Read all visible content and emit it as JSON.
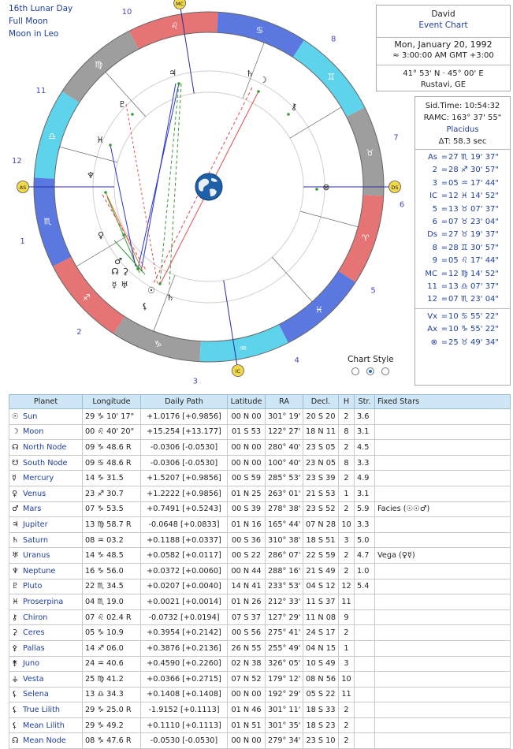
{
  "moon_info": {
    "line1": "16th Lunar Day",
    "line2": "Full Moon",
    "line3": "Moon in Leo"
  },
  "event": {
    "name": "David",
    "type": "Event Chart",
    "date": "Mon, January 20, 1992",
    "time": "≈ 3:00:00 AM  GMT +3:00",
    "coords": "41° 53' N · 45° 00' E",
    "place": "Rustavi, GE"
  },
  "sidereal": {
    "sid_time": "Sid.Time: 10:54:32",
    "ramc": "RAMC: 163° 37' 55\"",
    "system": "Placidus",
    "delta_t": "ΔT: 58.3 sec"
  },
  "cusps": [
    {
      "label": "As",
      "sign": "♏",
      "pos": "27 ♏ 19' 37\""
    },
    {
      "label": "2",
      "sign": "♐",
      "pos": "28 ♐ 30' 57\""
    },
    {
      "label": "3",
      "sign": "♒",
      "pos": "05 ♒ 17' 44\""
    },
    {
      "label": "IC",
      "sign": "♓",
      "pos": "12 ♓ 14' 52\""
    },
    {
      "label": "5",
      "sign": "♉",
      "pos": "13 ♉ 07' 37\""
    },
    {
      "label": "6",
      "sign": "♉",
      "pos": "07 ♉ 23' 04\""
    },
    {
      "label": "Ds",
      "sign": "♉",
      "pos": "27 ♉ 19' 37\""
    },
    {
      "label": "8",
      "sign": "♊",
      "pos": "28 ♊ 30' 57\""
    },
    {
      "label": "9",
      "sign": "♌",
      "pos": "05 ♌ 17' 44\""
    },
    {
      "label": "MC",
      "sign": "♍",
      "pos": "12 ♍ 14' 52\""
    },
    {
      "label": "11",
      "sign": "♎",
      "pos": "13 ♎ 07' 37\""
    },
    {
      "label": "12",
      "sign": "♏",
      "pos": "07 ♏ 23' 04\""
    }
  ],
  "cusps_display": [
    "27 ♏ 19' 37\"",
    "28 ♐ 30' 57\"",
    "05 ♒ 17' 44\"",
    "12 ♓ 14' 52\"",
    "13 ♉ 07' 37\"",
    "07 ♉ 23' 04\"",
    "27 ♉ 19' 37\"",
    "28 ♊ 30' 57\"",
    "05 ♌ 17' 44\"",
    "12 ♍ 14' 52\"",
    "13 ♎ 07' 37\"",
    "07 ♏ 23' 04\""
  ],
  "points": [
    {
      "label": "Vx",
      "value": "10 ♋ 55' 22\""
    },
    {
      "label": "Ax",
      "value": "10 ♑ 55' 22\""
    },
    {
      "label": "⊗",
      "value": "25 ♉ 49' 34\""
    }
  ],
  "chart_style_label": "Chart Style",
  "house_numbers": [
    "1",
    "2",
    "3",
    "4",
    "5",
    "6",
    "7",
    "8",
    "9",
    "10",
    "11",
    "12"
  ],
  "angle_labels": {
    "as": "AS",
    "ds": "DS",
    "mc": "MC",
    "ic": "IC"
  },
  "table": {
    "headers": [
      "Planet",
      "Longitude",
      "Daily Path",
      "Latitude",
      "RA",
      "Decl.",
      "H",
      "Str.",
      "Fixed Stars"
    ],
    "rows": [
      {
        "glyph": "☉",
        "name": "Sun",
        "lon": "29 ♑ 10' 17\"",
        "path": "+1.0176 [+0.9856]",
        "lat": "00 N 00",
        "ra": "301° 19'",
        "decl": "20 S 20",
        "h": "2",
        "str": "3.6",
        "stars": ""
      },
      {
        "glyph": "☽",
        "name": "Moon",
        "lon": "00 ♌ 40' 20\"",
        "path": "+15.254 [+13.177]",
        "lat": "01 S 53",
        "ra": "122° 27'",
        "decl": "18 N 11",
        "h": "8",
        "str": "3.1",
        "stars": ""
      },
      {
        "glyph": "☊",
        "name": "North Node",
        "lon": "09 ♑ 48.6 R",
        "path": "-0.0306 [-0.0530]",
        "lat": "00 N 00",
        "ra": "280° 40'",
        "decl": "23 S 05",
        "h": "2",
        "str": "4.5",
        "stars": ""
      },
      {
        "glyph": "☋",
        "name": "South Node",
        "lon": "09 ♋ 48.6 R",
        "path": "-0.0306 [-0.0530]",
        "lat": "00 N 00",
        "ra": "100° 40'",
        "decl": "23 N 05",
        "h": "8",
        "str": "3.3",
        "stars": ""
      },
      {
        "glyph": "☿",
        "name": "Mercury",
        "lon": "14 ♑ 31.5",
        "path": "+1.5207 [+0.9856]",
        "lat": "00 S 59",
        "ra": "285° 53'",
        "decl": "23 S 39",
        "h": "2",
        "str": "4.9",
        "stars": ""
      },
      {
        "glyph": "♀",
        "name": "Venus",
        "lon": "23 ♐ 30.7",
        "path": "+1.2222 [+0.9856]",
        "lat": "01 N 25",
        "ra": "263° 01'",
        "decl": "21 S 53",
        "h": "1",
        "str": "3.1",
        "stars": ""
      },
      {
        "glyph": "♂",
        "name": "Mars",
        "lon": "07 ♑ 53.5",
        "path": "+0.7491 [+0.5243]",
        "lat": "00 S 39",
        "ra": "278° 38'",
        "decl": "23 S 52",
        "h": "2",
        "str": "5.9",
        "stars": "Facies (☉☉♂)"
      },
      {
        "glyph": "♃",
        "name": "Jupiter",
        "lon": "13 ♍ 58.7 R",
        "path": "-0.0648 [+0.0833]",
        "lat": "01 N 16",
        "ra": "165° 44'",
        "decl": "07 N 28",
        "h": "10",
        "str": "3.3",
        "stars": ""
      },
      {
        "glyph": "♄",
        "name": "Saturn",
        "lon": "08 ♒ 03.2",
        "path": "+0.1188 [+0.0337]",
        "lat": "00 S 36",
        "ra": "310° 38'",
        "decl": "18 S 51",
        "h": "3",
        "str": "5.0",
        "stars": ""
      },
      {
        "glyph": "♅",
        "name": "Uranus",
        "lon": "14 ♑ 48.5",
        "path": "+0.0582 [+0.0117]",
        "lat": "00 S 22",
        "ra": "286° 07'",
        "decl": "22 S 59",
        "h": "2",
        "str": "4.7",
        "stars": "Vega (♀☿)"
      },
      {
        "glyph": "♆",
        "name": "Neptune",
        "lon": "16 ♑ 56.0",
        "path": "+0.0372 [+0.0060]",
        "lat": "00 N 44",
        "ra": "288° 16'",
        "decl": "21 S 49",
        "h": "2",
        "str": "1.0",
        "stars": ""
      },
      {
        "glyph": "♇",
        "name": "Pluto",
        "lon": "22 ♏ 34.5",
        "path": "+0.0207 [+0.0040]",
        "lat": "14 N 41",
        "ra": "233° 53'",
        "decl": "04 S 12",
        "h": "12",
        "str": "5.4",
        "stars": ""
      },
      {
        "glyph": "♓",
        "name": "Proserpina",
        "lon": "04 ♏ 19.0",
        "path": "+0.0021 [+0.0014]",
        "lat": "01 N 26",
        "ra": "212° 33'",
        "decl": "11 S 37",
        "h": "11",
        "str": "",
        "stars": ""
      },
      {
        "glyph": "⚷",
        "name": "Chiron",
        "lon": "07 ♌ 02.4 R",
        "path": "-0.0732 [+0.0194]",
        "lat": "07 S 37",
        "ra": "127° 29'",
        "decl": "11 N 08",
        "h": "9",
        "str": "",
        "stars": ""
      },
      {
        "glyph": "⚳",
        "name": "Ceres",
        "lon": "05 ♑ 10.9",
        "path": "+0.3954 [+0.2142]",
        "lat": "00 S 56",
        "ra": "275° 41'",
        "decl": "24 S 17",
        "h": "2",
        "str": "",
        "stars": ""
      },
      {
        "glyph": "⚴",
        "name": "Pallas",
        "lon": "14 ♐ 06.0",
        "path": "+0.3876 [+0.2136]",
        "lat": "26 N 55",
        "ra": "255° 49'",
        "decl": "04 N 15",
        "h": "1",
        "str": "",
        "stars": ""
      },
      {
        "glyph": "⚵",
        "name": "Juno",
        "lon": "24 ♒ 40.6",
        "path": "+0.4590 [+0.2260]",
        "lat": "02 N 38",
        "ra": "326° 05'",
        "decl": "10 S 49",
        "h": "3",
        "str": "",
        "stars": ""
      },
      {
        "glyph": "⚶",
        "name": "Vesta",
        "lon": "25 ♍ 41.2",
        "path": "+0.0366 [+0.2715]",
        "lat": "07 N 52",
        "ra": "179° 12'",
        "decl": "08 N 56",
        "h": "10",
        "str": "",
        "stars": ""
      },
      {
        "glyph": "⚸",
        "name": "Selena",
        "lon": "13 ♎ 34.3",
        "path": "+0.1408 [+0.1408]",
        "lat": "00 N 00",
        "ra": "192° 29'",
        "decl": "05 S 22",
        "h": "11",
        "str": "",
        "stars": ""
      },
      {
        "glyph": "⚸",
        "name": "True Lilith",
        "lon": "29 ♑ 25.0 R",
        "path": "-1.9152 [+0.1113]",
        "lat": "01 N 46",
        "ra": "301° 11'",
        "decl": "18 S 33",
        "h": "2",
        "str": "",
        "stars": ""
      },
      {
        "glyph": "⚸",
        "name": "Mean Lilith",
        "lon": "29 ♑ 49.2",
        "path": "+0.1110 [+0.1113]",
        "lat": "01 N 51",
        "ra": "301° 35'",
        "decl": "18 S 23",
        "h": "2",
        "str": "",
        "stars": ""
      },
      {
        "glyph": "☊",
        "name": "Mean Node",
        "lon": "08 ♑ 47.6 R",
        "path": "-0.0530 [-0.0530]",
        "lat": "00 N 00",
        "ra": "279° 34'",
        "decl": "23 S 10",
        "h": "2",
        "str": "",
        "stars": ""
      }
    ]
  }
}
